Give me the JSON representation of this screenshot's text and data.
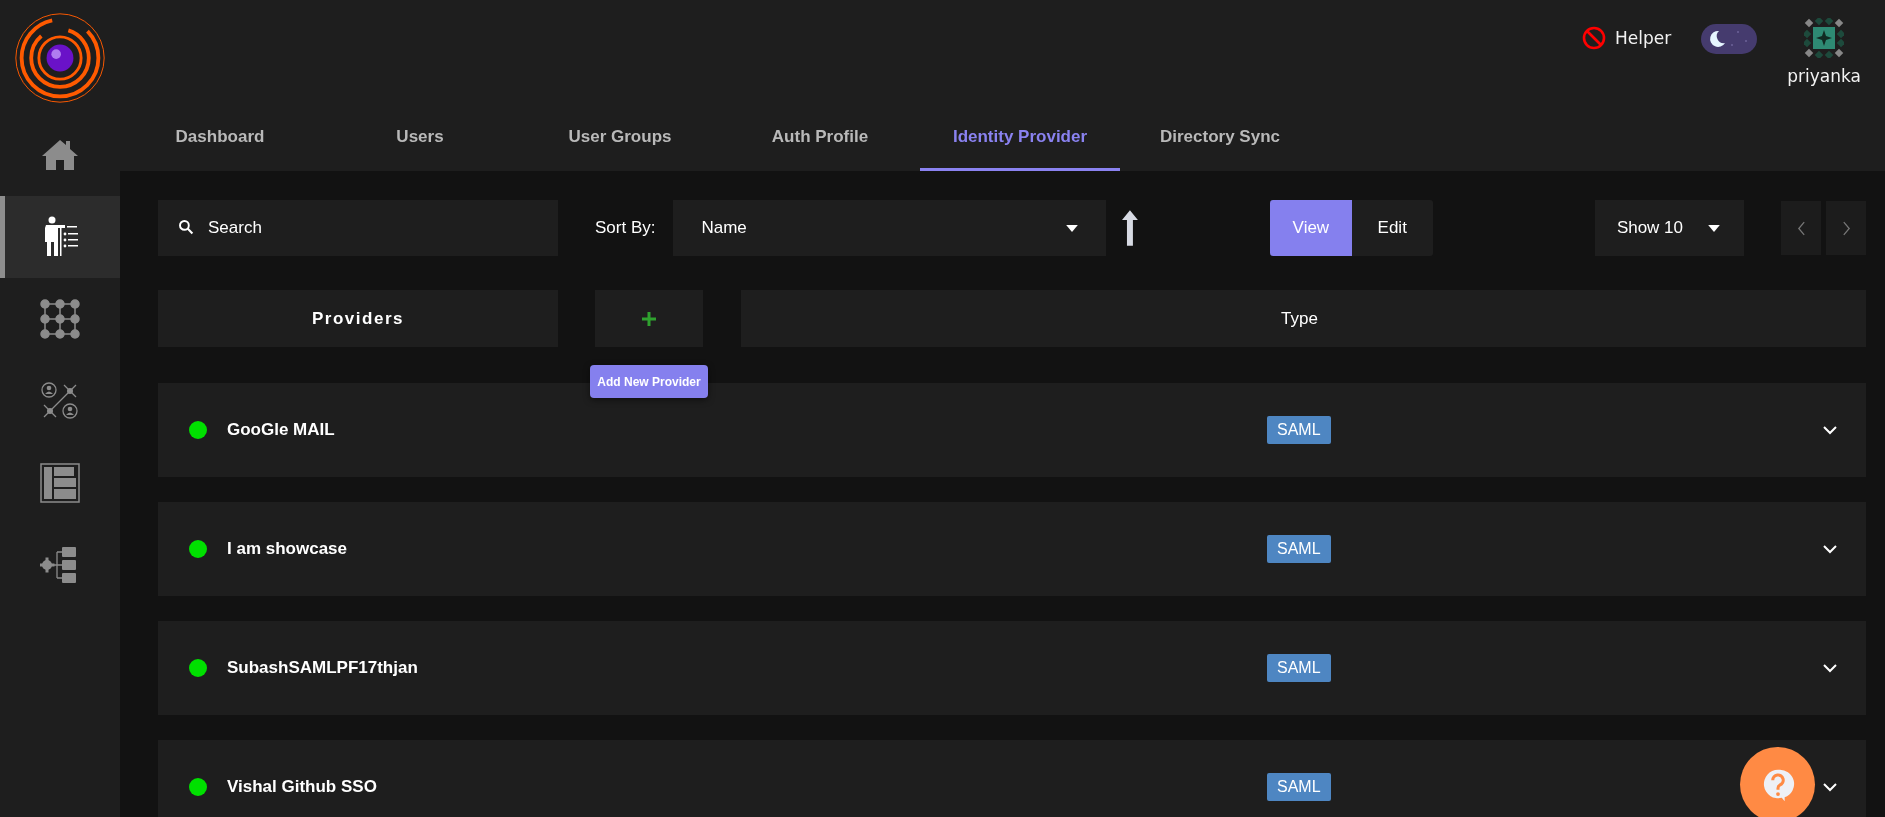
{
  "sidebar": {
    "items": [
      {
        "kind": "home",
        "selected": false
      },
      {
        "kind": "presenter",
        "selected": true
      },
      {
        "kind": "grid",
        "selected": false
      },
      {
        "kind": "network",
        "selected": false
      },
      {
        "kind": "layout",
        "selected": false
      },
      {
        "kind": "settings-tree",
        "selected": false
      }
    ]
  },
  "header": {
    "helper": {
      "label": "Helper",
      "enabled": false
    },
    "dark_mode": true,
    "user": "priyanka"
  },
  "tabs": [
    {
      "label": "Dashboard",
      "selected": false
    },
    {
      "label": "Users",
      "selected": false
    },
    {
      "label": "User Groups",
      "selected": false
    },
    {
      "label": "Auth Profile",
      "selected": false
    },
    {
      "label": "Identity Provider",
      "selected": true
    },
    {
      "label": "Directory Sync",
      "selected": false
    }
  ],
  "toolbar": {
    "search": {
      "placeholder": "Search"
    },
    "sort_label": "Sort By:",
    "sort_value": "Name",
    "view_modes": [
      {
        "label": "View",
        "selected": true
      },
      {
        "label": "Edit",
        "selected": false
      }
    ],
    "page_size": "Show 10"
  },
  "table": {
    "columns": {
      "providers": "Providers",
      "add_tooltip": "Add New Provider",
      "type": "Type"
    },
    "rows": [
      {
        "name": "GooGle MAIL",
        "active": true,
        "type": "SAML",
        "expanded": false
      },
      {
        "name": "I am showcase",
        "active": true,
        "type": "SAML",
        "expanded": false
      },
      {
        "name": "SubashSAMLPF17thjan",
        "active": true,
        "type": "SAML",
        "expanded": false
      },
      {
        "name": "Vishal Github SSO",
        "active": true,
        "type": "SAML",
        "expanded": false
      }
    ]
  }
}
